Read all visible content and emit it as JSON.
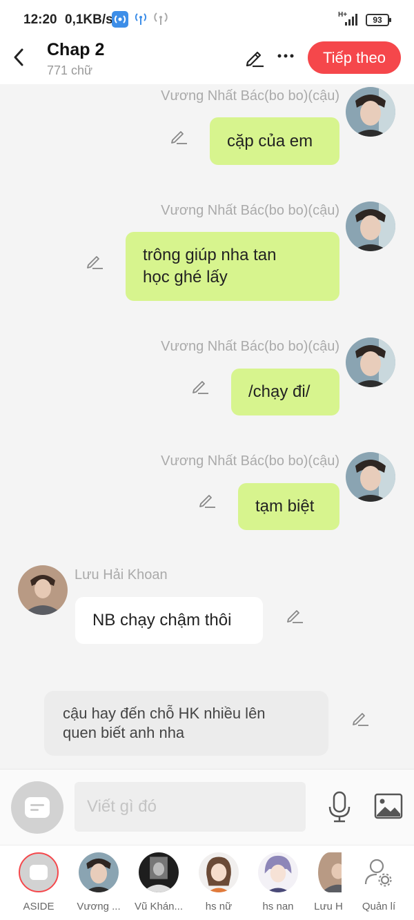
{
  "status_bar": {
    "time": "12:20",
    "speed": "0,1KB/s",
    "battery": "93",
    "network": "H+"
  },
  "header": {
    "title": "Chap 2",
    "word_count": "771 chữ",
    "next_label": "Tiếp theo"
  },
  "messages": [
    {
      "sender": "Vương Nhất Bác(bo bo)(cậu)",
      "lines": [
        "cặp của em"
      ]
    },
    {
      "sender": "Vương Nhất Bác(bo bo)(cậu)",
      "lines": [
        "trông giúp nha tan",
        "học ghé lấy"
      ]
    },
    {
      "sender": "Vương Nhất Bác(bo bo)(cậu)",
      "lines": [
        "/chạy đi/"
      ]
    },
    {
      "sender": "Vương Nhất Bác(bo bo)(cậu)",
      "lines": [
        "tạm biệt"
      ]
    },
    {
      "sender": "Lưu Hải Khoan",
      "lines": [
        "NB chạy chậm thôi"
      ]
    }
  ],
  "aside_message": {
    "lines": [
      "cậu hay đến chỗ HK nhiều lên",
      "quen biết anh nha"
    ]
  },
  "input": {
    "placeholder": "Viết gì đó"
  },
  "characters": [
    {
      "label": "ASIDE"
    },
    {
      "label": "Vương ..."
    },
    {
      "label": "Vũ Khán..."
    },
    {
      "label": "hs nữ"
    },
    {
      "label": "hs nan"
    },
    {
      "label": "Lưu H"
    },
    {
      "label": "Quản lí"
    }
  ],
  "colors": {
    "accent": "#f5474b",
    "bubble_green": "#d7f48e",
    "aside_bubble": "#ececec"
  },
  "icons": [
    "back-icon",
    "edit-icon",
    "more-icon",
    "mic-icon",
    "image-icon",
    "manage-icon",
    "aside-icon"
  ]
}
